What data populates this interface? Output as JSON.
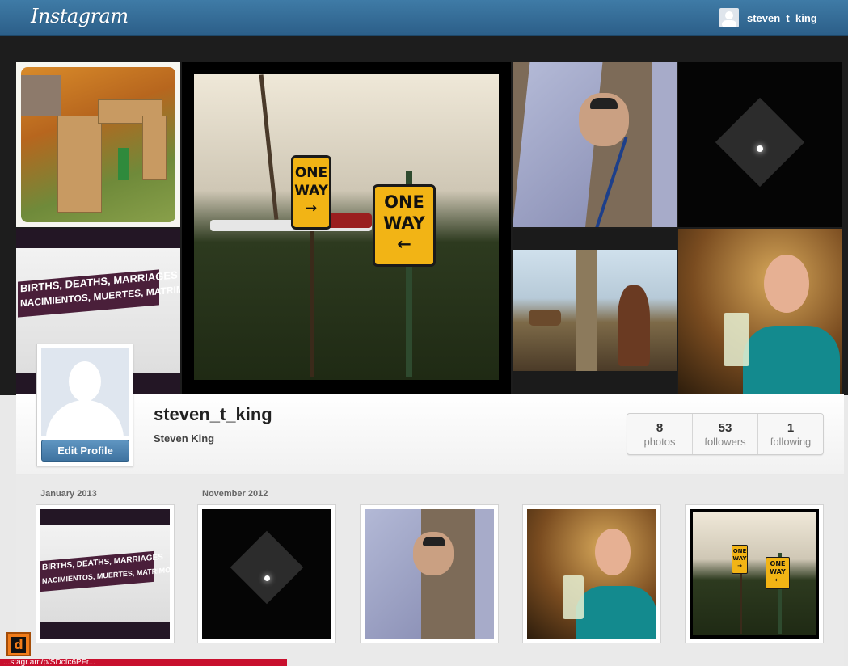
{
  "header": {
    "logo": "Instagram",
    "username": "steven_t_king"
  },
  "mosaic": {
    "births_sign": {
      "line1": "BIRTHS, DEATHS, MARRIAGES",
      "line2": "NACIMIENTOS, MUERTES, MATRIMONIOS"
    },
    "oneway_signs": [
      {
        "line1": "ONE",
        "line2": "WAY",
        "arrow": "→"
      },
      {
        "line1": "ONE",
        "line2": "WAY",
        "arrow": "←"
      }
    ]
  },
  "profile": {
    "username": "steven_t_king",
    "full_name": "Steven King",
    "edit_label": "Edit Profile",
    "stats": [
      {
        "num": "8",
        "label": "photos"
      },
      {
        "num": "53",
        "label": "followers"
      },
      {
        "num": "1",
        "label": "following"
      }
    ]
  },
  "feed": {
    "months": [
      "January 2013",
      "November 2012"
    ],
    "thumb_births": {
      "line1": "BIRTHS, DEATHS, MARRIAGES",
      "line2": "NACIMIENTOS, MUERTES, MATRIMONIOS"
    },
    "thumb_oneway": [
      {
        "line1": "ONE",
        "line2": "WAY",
        "arrow": "→"
      },
      {
        "line1": "ONE",
        "line2": "WAY",
        "arrow": "←"
      }
    ]
  },
  "statusbar": {
    "url": "...stagr.am/p/SDcfc6PFr..."
  },
  "colors": {
    "topbar": "#2c5f89",
    "button": "#3f73a0",
    "sign_yellow": "#f2b415"
  }
}
